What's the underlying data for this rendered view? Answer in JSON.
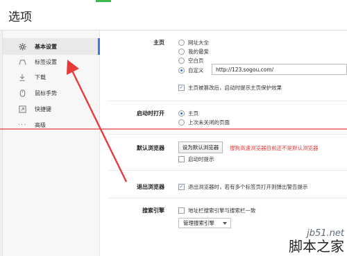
{
  "window": {
    "title": "选项"
  },
  "sidebar": {
    "items": [
      {
        "label": "基本设置",
        "icon": "gear-icon"
      },
      {
        "label": "标签设置",
        "icon": "tab-icon"
      },
      {
        "label": "下载",
        "icon": "download-icon"
      },
      {
        "label": "鼠标手势",
        "icon": "mouse-icon"
      },
      {
        "label": "快捷键",
        "icon": "shortcut-icon"
      },
      {
        "label": "高级",
        "icon": "more-icon"
      }
    ]
  },
  "homepage": {
    "label": "主页",
    "options": [
      "网址大全",
      "我的最爱",
      "空白页",
      "自定义"
    ],
    "selected": "自定义",
    "url_value": "http://123.sogou.com/",
    "protect_label": "主页被篡改后，启动时提示主页保护效果",
    "protect_checked": true
  },
  "startup": {
    "label": "启动时打开",
    "options": [
      "主页",
      "上次未关闭的页面"
    ],
    "selected": "主页"
  },
  "default_browser": {
    "label": "默认浏览器",
    "button_label": "设为默认浏览器",
    "warning": "搜狗高速浏览器目前还不是默认浏览器",
    "startup_prompt_label": "启动时提示",
    "startup_prompt_checked": false
  },
  "exit_browser": {
    "label": "退出浏览器",
    "warn_label": "退出浏览器时，若有多个标签页打开则弹出警告提示",
    "warn_checked": true
  },
  "search_engine": {
    "label": "搜索引擎",
    "sync_label": "地址栏搜索引擎与搜索栏一致",
    "sync_checked": false,
    "manage_label": "管理搜索引擎"
  },
  "watermark": {
    "top": "jb51.net",
    "bottom": "脚本之家"
  },
  "colors": {
    "annotation": "#e53b3b",
    "accent": "#3b7be0",
    "tab_accent": "#40b850"
  }
}
